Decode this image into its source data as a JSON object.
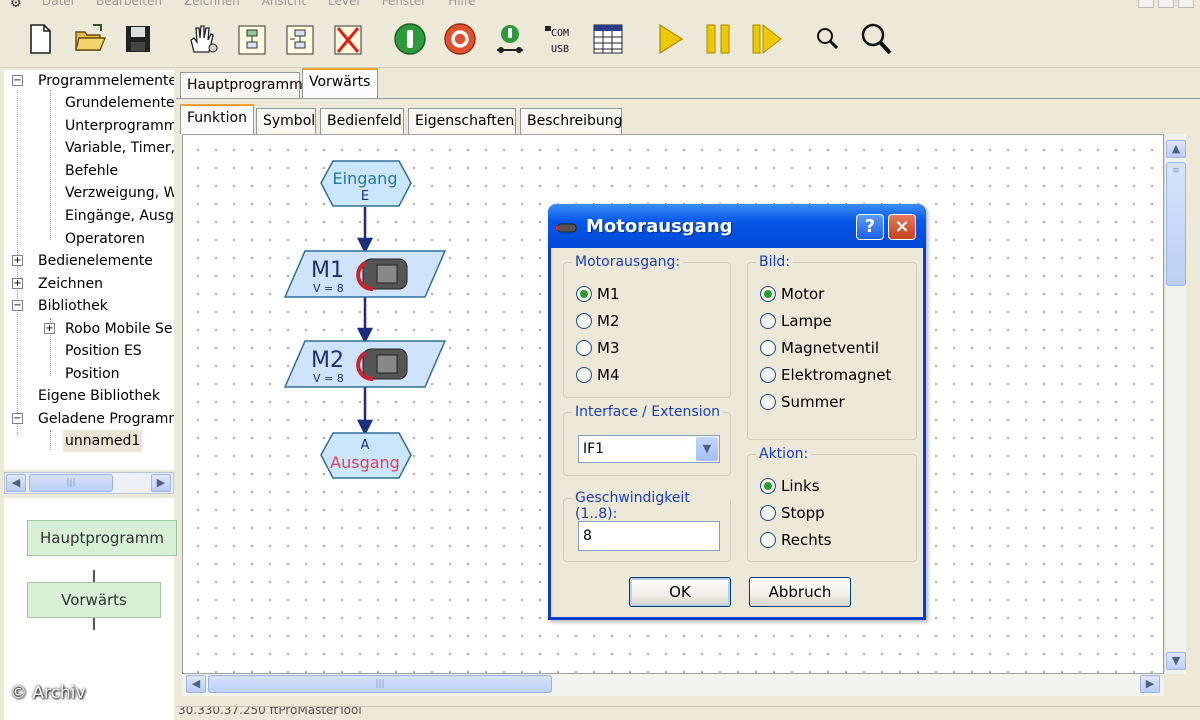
{
  "menu": {
    "items": [
      "Datei",
      "Bearbeiten",
      "Zeichnen",
      "Ansicht",
      "Level",
      "Fenster",
      "Hilfe"
    ]
  },
  "toolbar": {
    "buttons": [
      "new-file",
      "open-folder",
      "save",
      "hand-tool",
      "new-subprogram",
      "new-subprogram-io",
      "delete-subprogram",
      "start-online",
      "stop",
      "download",
      "com-usb",
      "test-panel",
      "play",
      "pause",
      "step",
      "zoom-out",
      "zoom-in"
    ],
    "com_label": "COM",
    "usb_label": "USB"
  },
  "tree": {
    "nodes": [
      {
        "label": "Programmelemente",
        "expander": "−"
      },
      {
        "label": "Grundelemente"
      },
      {
        "label": "Unterprogramm"
      },
      {
        "label": "Variable, Timer,"
      },
      {
        "label": "Befehle"
      },
      {
        "label": "Verzweigung, W"
      },
      {
        "label": "Eingänge, Ausg"
      },
      {
        "label": "Operatoren"
      },
      {
        "label": "Bedienelemente",
        "expander": "+"
      },
      {
        "label": "Zeichnen",
        "expander": "+"
      },
      {
        "label": "Bibliothek",
        "expander": "−"
      },
      {
        "label": "Robo Mobile Se",
        "expander": "+"
      },
      {
        "label": "Position ES"
      },
      {
        "label": "Position"
      },
      {
        "label": "Eigene Bibliothek"
      },
      {
        "label": "Geladene Programm",
        "expander": "−"
      },
      {
        "label": "unnamed1"
      }
    ]
  },
  "overview": {
    "main": "Hauptprogramm",
    "sub": "Vorwärts"
  },
  "watermark": "© Archiv",
  "tabs": {
    "programs": [
      "Hauptprogramm",
      "Vorwärts"
    ],
    "active_program": "Vorwärts",
    "views": [
      "Funktion",
      "Symbol",
      "Bedienfeld",
      "Eigenschaften",
      "Beschreibung"
    ],
    "active_view": "Funktion"
  },
  "flow": {
    "input_title": "Eingang",
    "input_sub": "E",
    "motor1_name": "M1",
    "motor1_speed": "V = 8",
    "motor2_name": "M2",
    "motor2_speed": "V = 8",
    "output_top": "A",
    "output_title": "Ausgang"
  },
  "dialog": {
    "title": "Motorausgang",
    "help": "?",
    "close": "×",
    "motor_group": "Motorausgang:",
    "motor_options": [
      "M1",
      "M2",
      "M3",
      "M4"
    ],
    "motor_selected": "M1",
    "bild_group": "Bild:",
    "bild_options": [
      "Motor",
      "Lampe",
      "Magnetventil",
      "Elektromagnet",
      "Summer"
    ],
    "bild_selected": "Motor",
    "interface_group": "Interface / Extension",
    "interface_value": "IF1",
    "speed_group": "Geschwindigkeit (1..8):",
    "speed_value": "8",
    "aktion_group": "Aktion:",
    "aktion_options": [
      "Links",
      "Stopp",
      "Rechts"
    ],
    "aktion_selected": "Links",
    "ok": "OK",
    "cancel": "Abbruch"
  },
  "statusbar": {
    "text": "30.330.37.250  ftProMasterTool"
  },
  "colors": {
    "accent_blue": "#0458e8",
    "input_fill": "#cce6ff",
    "input_border": "#2f6e9c",
    "flow_blue": "#cfe4fb",
    "flow_arrow": "#1c2f7a",
    "output_red": "#e04050",
    "radio_green": "#2f9a2f"
  }
}
